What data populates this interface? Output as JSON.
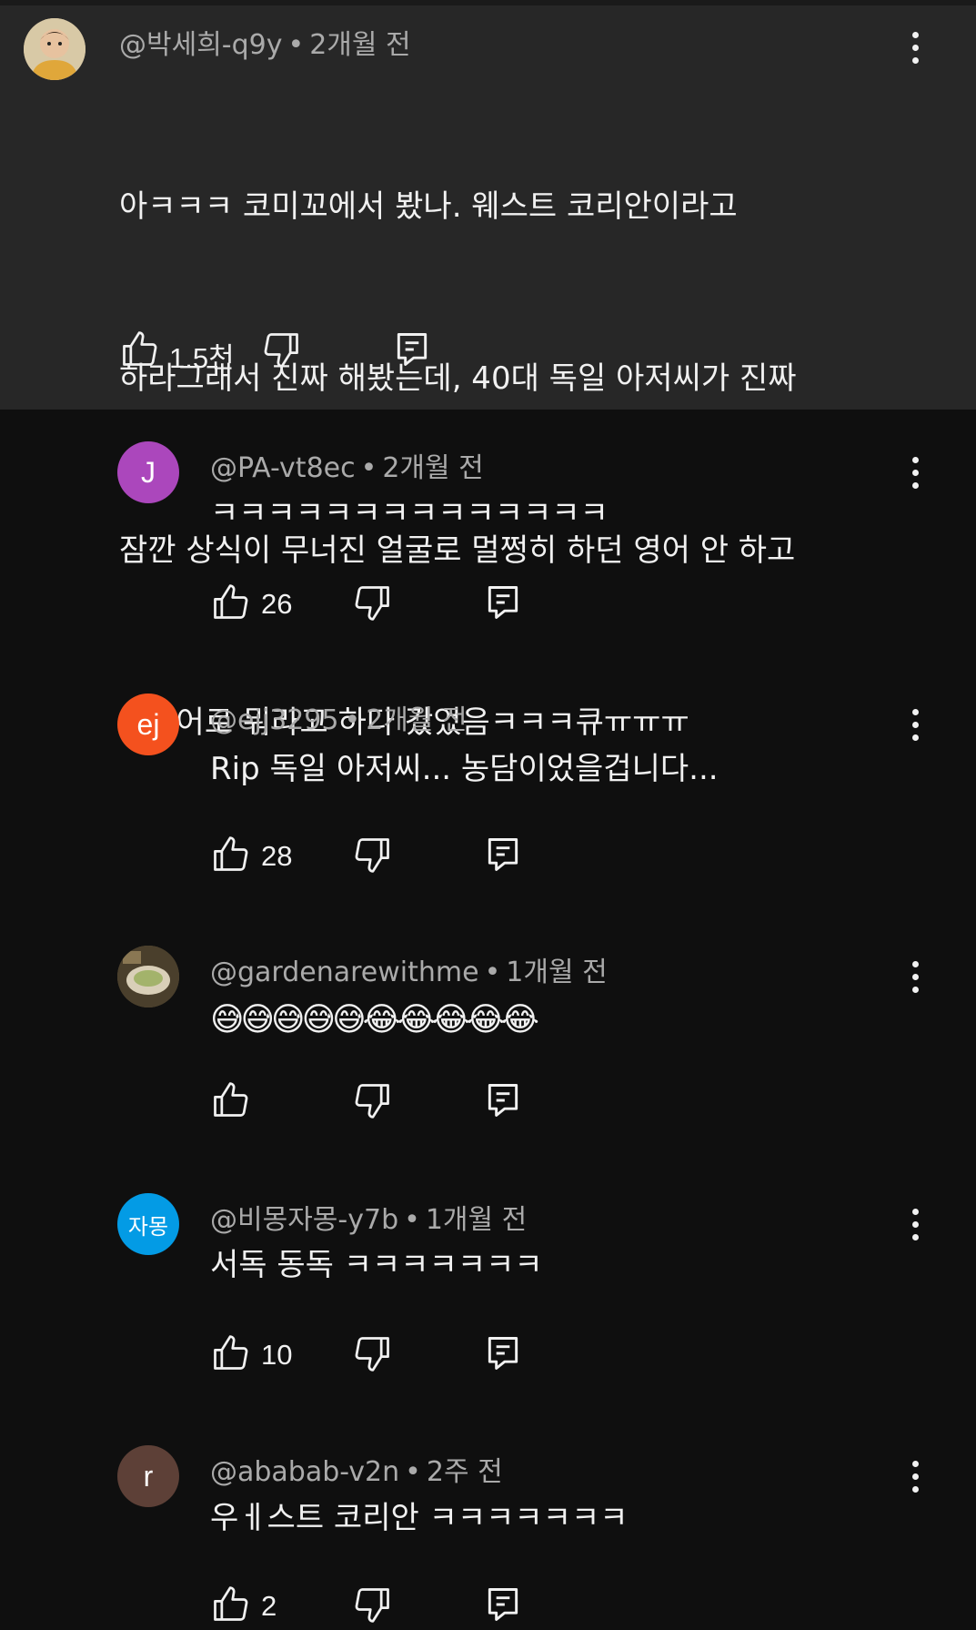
{
  "parent": {
    "handle": "@박세희-q9y",
    "time": "2개월 전",
    "lines": [
      "아ㅋㅋㅋ 코미꼬에서 봤나. 웨스트 코리안이라고",
      "하라그래서 진짜 해봤는데, 40대 독일 아저씨가 진짜",
      "잠깐 상식이 무너진 얼굴로 멀쩡히 하던 영어 안 하고",
      "독일어로 뭐라고 하다 갔었음ㅋㅋㅋ큐ㅠㅠㅠ"
    ],
    "likes": "1.5천",
    "avatar_icon": "child-photo-avatar"
  },
  "replies": [
    {
      "handle": "@PA-vt8ec",
      "time": "2개월 전",
      "text": "ㅋㅋㅋㅋㅋㅋㅋㅋㅋㅋㅋㅋㅋㅋ",
      "likes": "26",
      "avatar_letter": "J",
      "avatar_color": "#ab47bc"
    },
    {
      "handle": "@ejj3295",
      "time": "2개월 전",
      "text": "Rip 독일 아저씨... 농담이었을겁니다...",
      "likes": "28",
      "avatar_letter": "ej",
      "avatar_color": "#f4511e"
    },
    {
      "handle": "@gardenarewithme",
      "time": "1개월 전",
      "text": "😅😅😅😅😅😂😂😂😂😂",
      "likes": "",
      "avatar_letter": "",
      "avatar_color": "#6b5a3a"
    },
    {
      "handle": "@비몽자몽-y7b",
      "time": "1개월 전",
      "text": "서독 동독 ㅋㅋㅋㅋㅋㅋㅋ",
      "likes": "10",
      "avatar_letter": "자몽",
      "avatar_color": "#039be5"
    },
    {
      "handle": "@ababab-v2n",
      "time": "2주 전",
      "text": "우ㅔ스트 코리안 ㅋㅋㅋㅋㅋㅋㅋ",
      "likes": "2",
      "avatar_letter": "r",
      "avatar_color": "#5d4037"
    }
  ],
  "icons": {
    "like": "thumbs-up-icon",
    "dislike": "thumbs-down-icon",
    "reply": "reply-comment-icon",
    "menu": "more-vertical-icon"
  }
}
